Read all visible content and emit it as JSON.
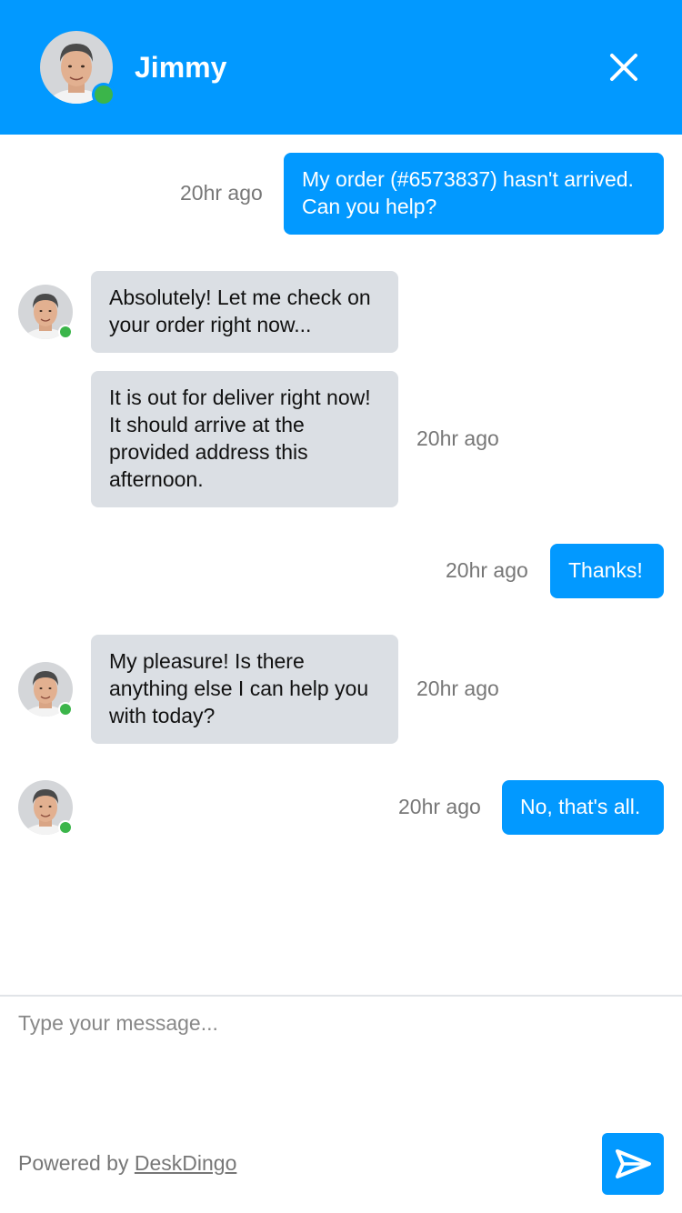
{
  "header": {
    "agent_name": "Jimmy",
    "status": "online"
  },
  "messages": [
    {
      "from": "user",
      "text": "My order (#6573837) hasn't arrived. Can you help?",
      "time": "20hr ago"
    },
    {
      "from": "agent",
      "text": "Absolutely! Let me check on your order right now...",
      "time": ""
    },
    {
      "from": "agent",
      "text": "It is out for deliver right now! It should arrive at the provided address this afternoon.",
      "time": "20hr ago"
    },
    {
      "from": "user",
      "text": "Thanks!",
      "time": "20hr ago"
    },
    {
      "from": "agent",
      "text": "My pleasure! Is there anything else I can help you with today?",
      "time": "20hr ago"
    },
    {
      "from": "user",
      "text": "No, that's all.",
      "time": "20hr ago"
    }
  ],
  "composer": {
    "placeholder": "Type your message...",
    "value": "",
    "powered_prefix": "Powered by",
    "brand": "DeskDingo"
  },
  "colors": {
    "primary": "#0299FF",
    "agent_bubble": "#DBDFE4",
    "online": "#3BB54A",
    "muted_text": "#777777"
  },
  "icons": {
    "close": "close-icon",
    "send": "send-icon",
    "avatar": "agent-avatar"
  }
}
